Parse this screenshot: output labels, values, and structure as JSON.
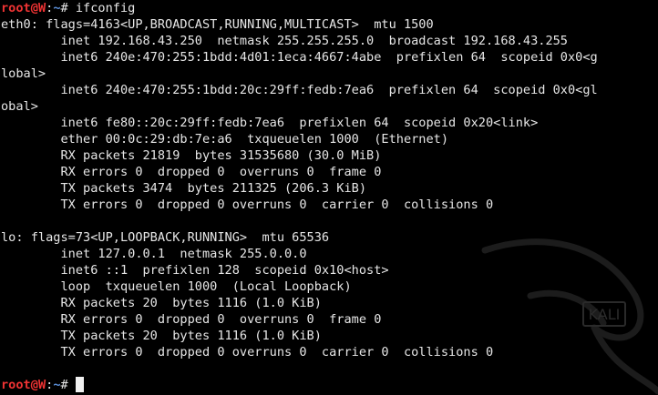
{
  "prompt": {
    "user": "root",
    "at": "@",
    "host": "W",
    "separator": ":",
    "path": "~",
    "symbol": "# "
  },
  "command": "ifconfig",
  "output_lines": [
    "eth0: flags=4163<UP,BROADCAST,RUNNING,MULTICAST>  mtu 1500",
    "        inet 192.168.43.250  netmask 255.255.255.0  broadcast 192.168.43.255",
    "        inet6 240e:470:255:1bdd:4d01:1eca:4667:4abe  prefixlen 64  scopeid 0x0<g",
    "lobal>",
    "        inet6 240e:470:255:1bdd:20c:29ff:fedb:7ea6  prefixlen 64  scopeid 0x0<gl",
    "obal>",
    "        inet6 fe80::20c:29ff:fedb:7ea6  prefixlen 64  scopeid 0x20<link>",
    "        ether 00:0c:29:db:7e:a6  txqueuelen 1000  (Ethernet)",
    "        RX packets 21819  bytes 31535680 (30.0 MiB)",
    "        RX errors 0  dropped 0  overruns 0  frame 0",
    "        TX packets 3474  bytes 211325 (206.3 KiB)",
    "        TX errors 0  dropped 0 overruns 0  carrier 0  collisions 0",
    "",
    "lo: flags=73<UP,LOOPBACK,RUNNING>  mtu 65536",
    "        inet 127.0.0.1  netmask 255.0.0.0",
    "        inet6 ::1  prefixlen 128  scopeid 0x10<host>",
    "        loop  txqueuelen 1000  (Local Loopback)",
    "        RX packets 20  bytes 1116 (1.0 KiB)",
    "        RX errors 0  dropped 0  overruns 0  frame 0",
    "        TX packets 20  bytes 1116 (1.0 KiB)",
    "        TX errors 0  dropped 0 overruns 0  carrier 0  collisions 0",
    ""
  ],
  "watermark": {
    "text": "KALI",
    "icon": "kali-dragon-icon"
  },
  "colors": {
    "background": "#000000",
    "text": "#e6e6e6",
    "prompt_user": "#ee3333",
    "prompt_path": "#5b8fd9"
  }
}
